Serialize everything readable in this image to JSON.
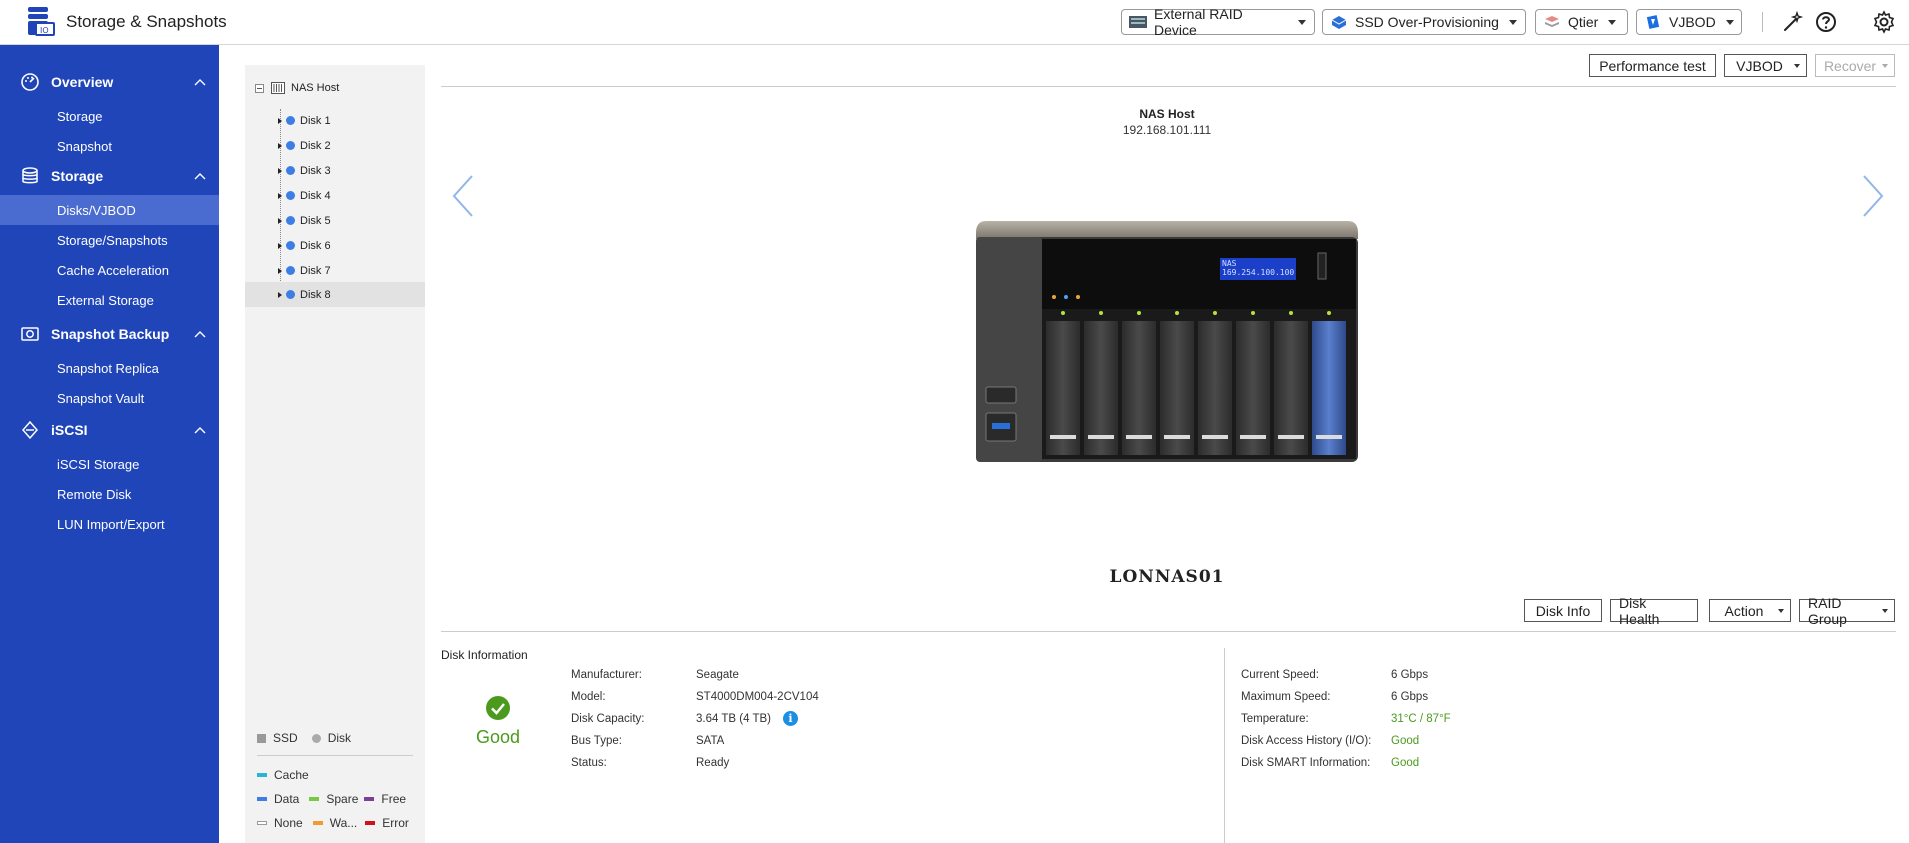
{
  "app": {
    "title": "Storage & Snapshots"
  },
  "toolbar": {
    "external_raid": "External RAID Device",
    "ssd_overprov": "SSD Over-Provisioning",
    "qtier": "Qtier",
    "vjbod": "VJBOD"
  },
  "sidebar": {
    "groups": [
      {
        "label": "Overview",
        "items": [
          "Storage",
          "Snapshot"
        ]
      },
      {
        "label": "Storage",
        "items": [
          "Disks/VJBOD",
          "Storage/Snapshots",
          "Cache Acceleration",
          "External Storage"
        ]
      },
      {
        "label": "Snapshot Backup",
        "items": [
          "Snapshot Replica",
          "Snapshot Vault"
        ]
      },
      {
        "label": "iSCSI",
        "items": [
          "iSCSI Storage",
          "Remote Disk",
          "LUN Import/Export"
        ]
      }
    ],
    "active_item": "Disks/VJBOD",
    "accent_color": "#1f45b8",
    "active_color": "#4a6bd0"
  },
  "tree": {
    "root": "NAS Host",
    "disks": [
      "Disk 1",
      "Disk 2",
      "Disk 3",
      "Disk 4",
      "Disk 5",
      "Disk 6",
      "Disk 7",
      "Disk 8"
    ],
    "selected": "Disk 8"
  },
  "legend": {
    "ssd": "SSD",
    "disk": "Disk",
    "cache": "Cache",
    "data": "Data",
    "spare": "Spare",
    "free": "Free",
    "none": "None",
    "warning": "Wa...",
    "error": "Error",
    "colors": {
      "cache": "#2ab4d6",
      "data": "#3e7de3",
      "spare": "#7ac943",
      "free": "#7b3f96",
      "none": "#ffffff",
      "warning": "#f29a2e",
      "error": "#d0121b"
    }
  },
  "top_actions": {
    "performance_test": "Performance test",
    "vjbod": "VJBOD",
    "recover": "Recover"
  },
  "host": {
    "name": "NAS Host",
    "ip": "192.168.101.111",
    "lcd_line1": "NAS",
    "lcd_line2": "169.254.100.100",
    "device_name": "LONNAS01"
  },
  "disk_actions": {
    "disk_info": "Disk Info",
    "disk_health": "Disk Health",
    "action": "Action",
    "raid_group": "RAID Group"
  },
  "disk_info": {
    "section_title": "Disk Information",
    "status_label": "Good",
    "left": [
      {
        "k": "Manufacturer:",
        "v": "Seagate"
      },
      {
        "k": "Model:",
        "v": "ST4000DM004-2CV104"
      },
      {
        "k": "Disk Capacity:",
        "v": "3.64 TB (4 TB)"
      },
      {
        "k": "Bus Type:",
        "v": "SATA"
      },
      {
        "k": "Status:",
        "v": "Ready"
      }
    ],
    "right": [
      {
        "k": "Current Speed:",
        "v": "6 Gbps"
      },
      {
        "k": "Maximum Speed:",
        "v": "6 Gbps"
      },
      {
        "k": "Temperature:",
        "v": "31°C / 87°F"
      },
      {
        "k": "Disk Access History (I/O):",
        "v": "Good"
      },
      {
        "k": "Disk SMART Information:",
        "v": "Good"
      }
    ]
  }
}
